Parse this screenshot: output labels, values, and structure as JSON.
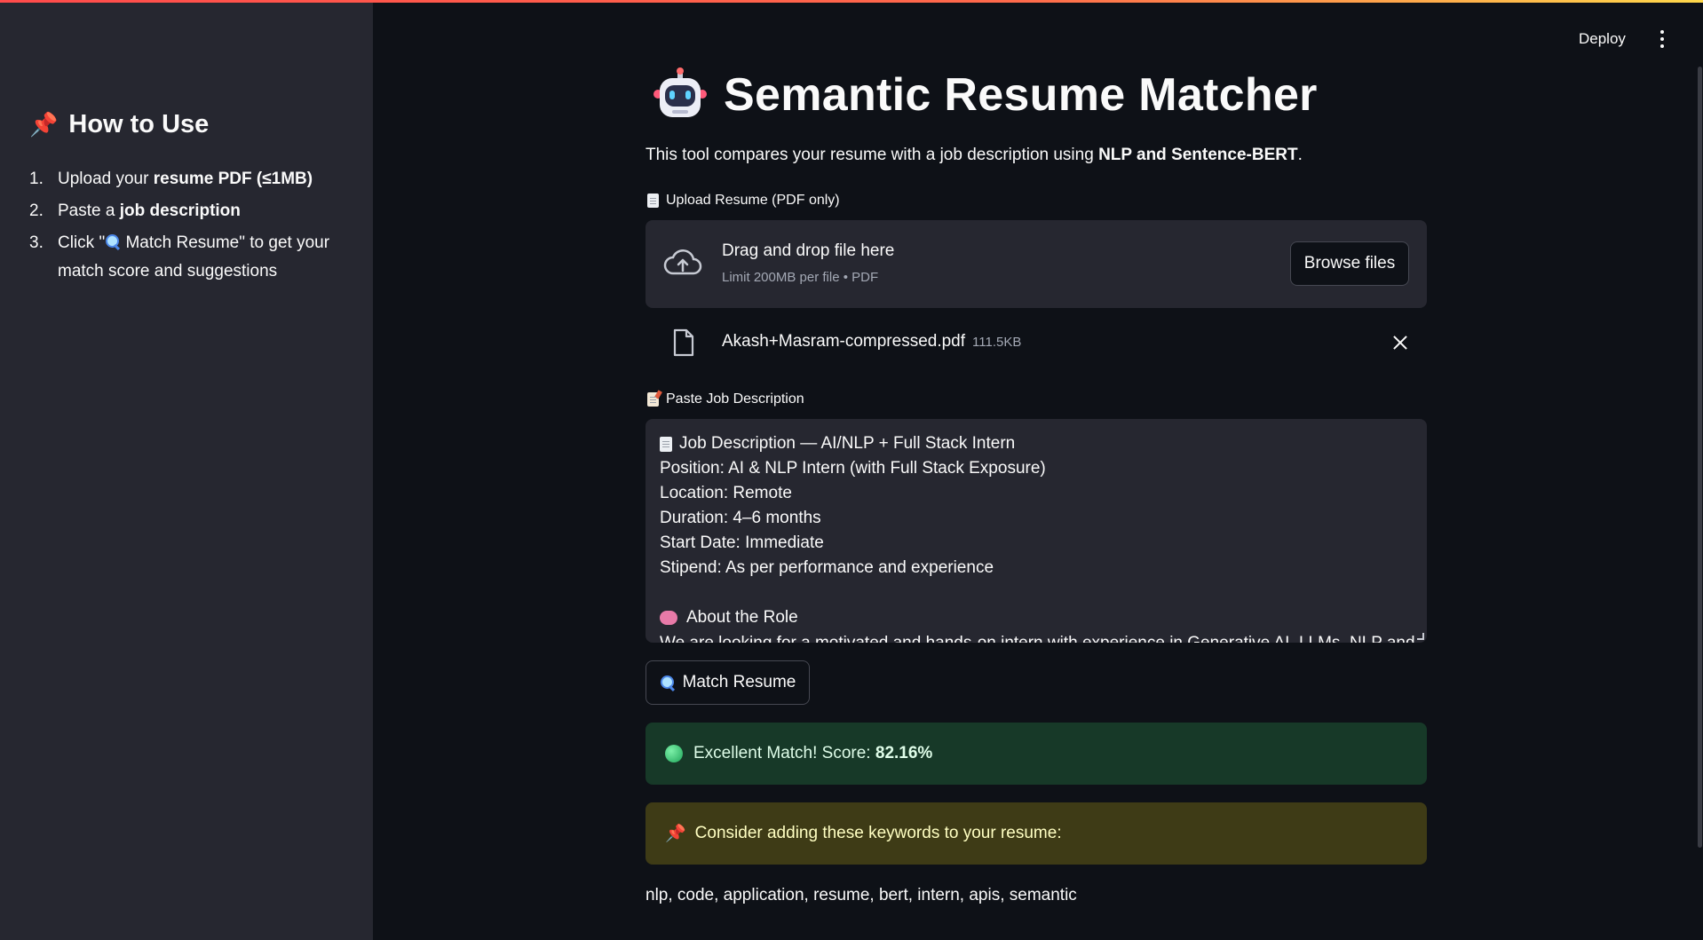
{
  "header": {
    "deploy_label": "Deploy"
  },
  "sidebar": {
    "heading": "How to Use",
    "steps": [
      {
        "num": "1.",
        "pre": "Upload your ",
        "bold": "resume PDF (≤1MB)",
        "post": ""
      },
      {
        "num": "2.",
        "pre": "Paste a ",
        "bold": "job description",
        "post": ""
      },
      {
        "num": "3.",
        "line1_pre": "Click \"",
        "line1_post": " Match Resume\" to get your",
        "line2": "match score and suggestions"
      }
    ]
  },
  "main": {
    "title": "Semantic Resume Matcher",
    "intro_pre": "This tool compares your resume with a job description using ",
    "intro_bold": "NLP and Sentence-BERT",
    "intro_post": ".",
    "upload_label": "Upload Resume (PDF only)",
    "dropzone": {
      "title": "Drag and drop file here",
      "subtitle": "Limit 200MB per file • PDF",
      "browse_label": "Browse files"
    },
    "file": {
      "name": "Akash+Masram-compressed.pdf",
      "size": "111.5KB"
    },
    "jd_label": "Paste Job Description",
    "jd_lines": [
      "Job Description — AI/NLP + Full Stack Intern",
      "Position: AI & NLP Intern (with Full Stack Exposure)",
      "Location: Remote",
      "Duration: 4–6 months",
      "Start Date: Immediate",
      "Stipend: As per performance and experience",
      "",
      "About the Role",
      "We are looking for a motivated and hands-on intern with experience in Generative AI, LLMs, NLP and"
    ],
    "match_button": "Match Resume",
    "success_pre": "Excellent Match! Score: ",
    "success_score": "82.16%",
    "warning_text": "Consider adding these keywords to your resume:",
    "keywords": "nlp, code, application, resume, bert, intern, apis, semantic"
  },
  "colors": {
    "app_bg": "#0e1117",
    "sidebar_bg": "#262730",
    "success_bg": "#173928",
    "warning_bg": "#3e3b16",
    "accent": "#ff4b4b"
  },
  "icons": [
    "pushpin-icon",
    "robot-icon",
    "page-icon",
    "memo-icon",
    "cloud-upload-icon",
    "file-icon",
    "close-icon",
    "magnifier-icon",
    "green-circle-icon",
    "brain-icon",
    "kebab-menu-icon"
  ]
}
